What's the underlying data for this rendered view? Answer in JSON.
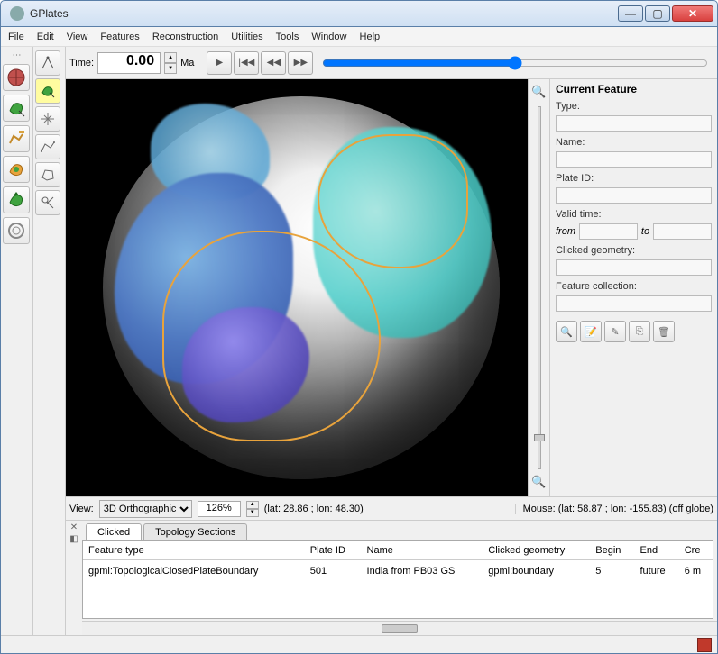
{
  "title": "GPlates",
  "menu": [
    "File",
    "Edit",
    "View",
    "Features",
    "Reconstruction",
    "Utilities",
    "Tools",
    "Window",
    "Help"
  ],
  "time": {
    "label": "Time:",
    "value": "0.00",
    "unit": "Ma"
  },
  "view_row": {
    "label": "View:",
    "projection": "3D Orthographic",
    "zoom": "126%",
    "camera": "(lat: 28.86 ; lon: 48.30)",
    "mouse": "Mouse: (lat: 58.87 ; lon: -155.83) (off globe)"
  },
  "right": {
    "header": "Current Feature",
    "type_lbl": "Type:",
    "name_lbl": "Name:",
    "plate_lbl": "Plate ID:",
    "valid_lbl": "Valid time:",
    "from": "from",
    "to": "to",
    "geom_lbl": "Clicked geometry:",
    "coll_lbl": "Feature collection:"
  },
  "bottom": {
    "tabs": [
      "Clicked",
      "Topology Sections"
    ],
    "columns": [
      "Feature type",
      "Plate ID",
      "Name",
      "Clicked geometry",
      "Begin",
      "End",
      "Cre"
    ],
    "rows": [
      {
        "feature_type": "gpml:TopologicalClosedPlateBoundary",
        "plate_id": "501",
        "name": "India from PB03 GS",
        "geom": "gpml:boundary",
        "begin": "5",
        "end": "future",
        "cre": "6 m"
      }
    ]
  }
}
